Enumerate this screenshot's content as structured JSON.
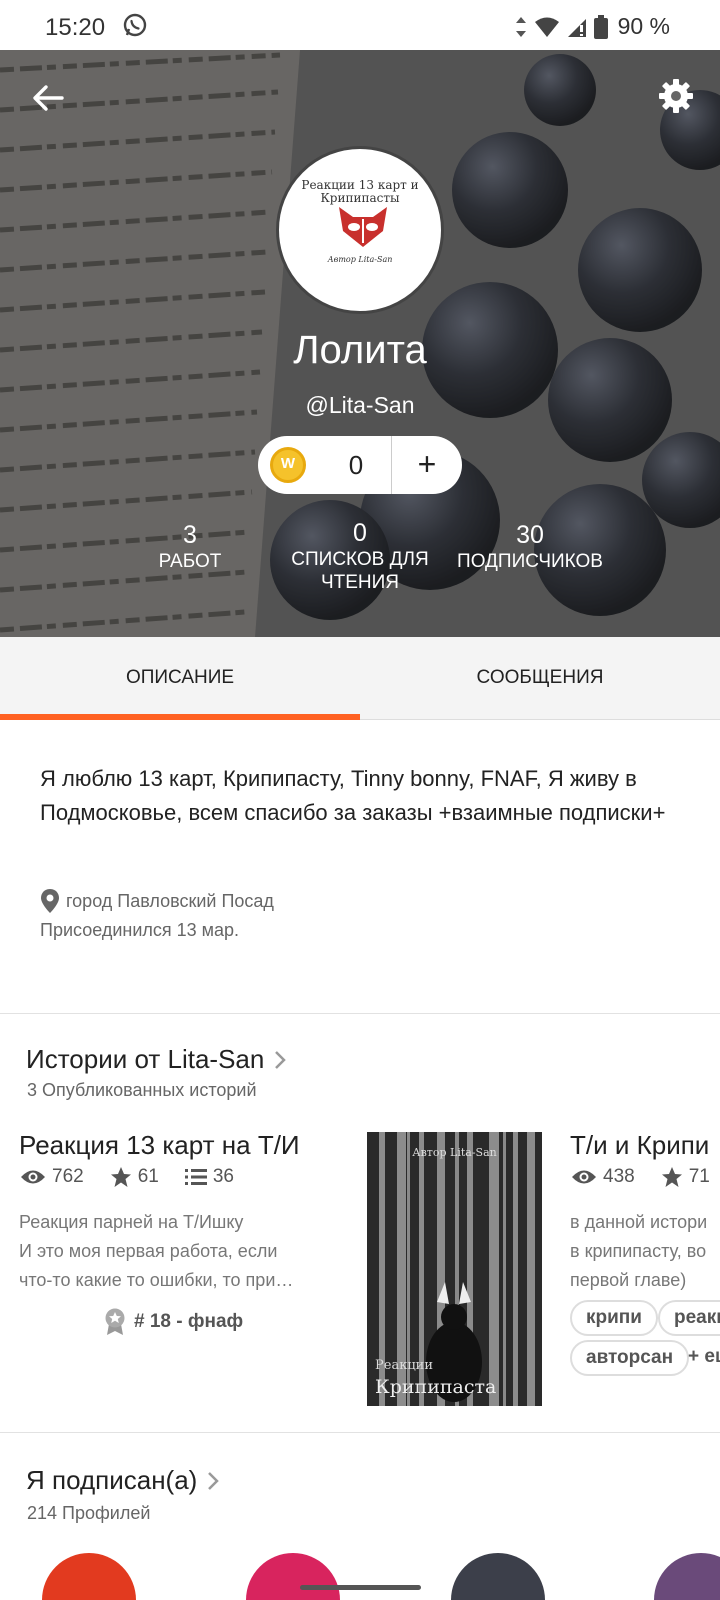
{
  "status_bar": {
    "time": "15:20",
    "battery": "90 %"
  },
  "profile": {
    "avatar_title": "Реакции 13 карт и Крипипасты",
    "avatar_signature": "Автор Lita-San",
    "name": "Лолита",
    "handle": "@Lita-San",
    "coins": "0",
    "coin_add": "+",
    "stats": [
      {
        "value": "3",
        "label": "РАБОТ"
      },
      {
        "value": "0",
        "label": "СПИСКОВ ДЛЯ ЧТЕНИЯ"
      },
      {
        "value": "30",
        "label": "ПОДПИСЧИКОВ"
      }
    ]
  },
  "tabs": [
    {
      "label": "ОПИСАНИЕ",
      "active": true
    },
    {
      "label": "СООБЩЕНИЯ",
      "active": false
    }
  ],
  "about": {
    "text": "Я люблю 13 карт, Крипипасту, Tinny bonny, FNAF, Я живу в Подмосковье, всем спасибо за заказы +взаимные подписки+",
    "location": "город Павловский Посад",
    "joined": "Присоединился 13 мар."
  },
  "stories_section": {
    "title": "Истории от Lita-San",
    "subtitle": "3 Опубликованных историй",
    "stories": [
      {
        "title": "Реакция 13 карт на Т/И",
        "views": "762",
        "votes": "61",
        "parts": "36",
        "desc_lines": [
          "Реакция парней на Т/Ишку",
          "И это моя первая работа, если",
          "что-то какие то ошибки, то при…"
        ],
        "rank": "# 18 - фнаф",
        "cover_author": "Автор Lita-San",
        "cover_small": "Реакции",
        "cover_big": "Крипипаста"
      },
      {
        "title": "Т/и и Крипи",
        "views": "438",
        "votes": "71",
        "desc_lines": [
          "в данной истори",
          "в крипипасту, во",
          "первой главе)"
        ],
        "tags": [
          "крипи",
          "реакц",
          "авторсан"
        ],
        "more_tags": "+ еще"
      }
    ]
  },
  "following_section": {
    "title": "Я подписан(а)",
    "subtitle": "214 Профилей"
  },
  "colors": {
    "accent": "#ff6122",
    "coin": "#f5c22b"
  }
}
